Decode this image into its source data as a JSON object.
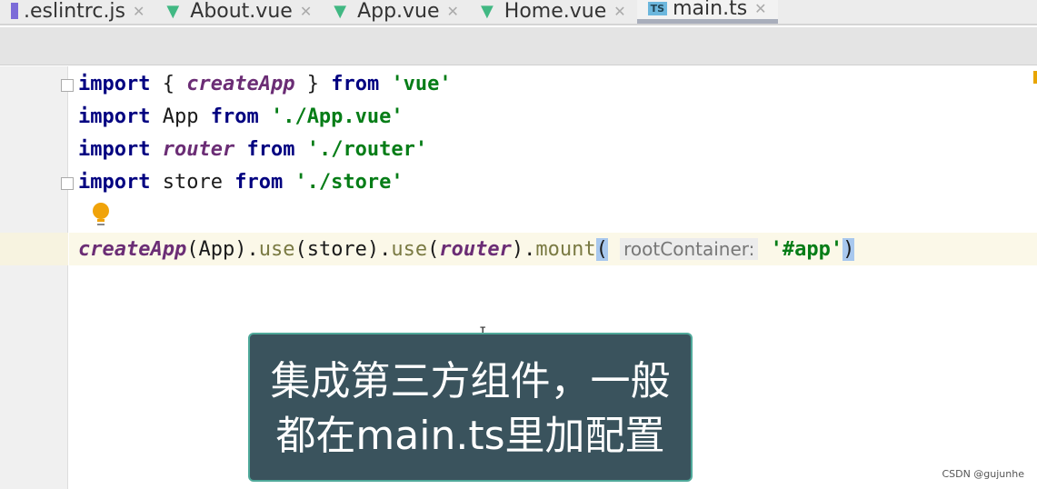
{
  "tabs": [
    {
      "label": ".eslintrc.js",
      "icon": "eslint-icon"
    },
    {
      "label": "About.vue",
      "icon": "vue-icon"
    },
    {
      "label": "App.vue",
      "icon": "vue-icon"
    },
    {
      "label": "Home.vue",
      "icon": "vue-icon"
    },
    {
      "label": "main.ts",
      "icon": "ts-icon",
      "active": true
    }
  ],
  "ts_badge": "TS",
  "code": {
    "l1": {
      "a": "import",
      "b": " { ",
      "c": "createApp",
      "d": " } ",
      "e": "from",
      "f": " ",
      "g": "'vue'"
    },
    "l2": {
      "a": "import",
      "b": " App ",
      "e": "from",
      "g": "'./App.vue'"
    },
    "l3": {
      "a": "import",
      "c": "router",
      "e": "from",
      "g": "'./router'"
    },
    "l4": {
      "a": "import",
      "b": " store ",
      "e": "from",
      "g": "'./store'"
    },
    "l6": {
      "fn": "createApp",
      "p1": "(App).",
      "use": "use",
      "p2": "(store).",
      "use2": "use",
      "p3": "(",
      "router": "router",
      "p4": ").",
      "mount": "mount",
      "open": "(",
      "hint": "rootContainer:",
      "str": "'#app'",
      "close": ")"
    }
  },
  "caption": {
    "line1": "集成第三方组件，一般",
    "line2": "都在main.ts里加配置"
  },
  "watermark": "CSDN @gujunhe",
  "colors": {
    "keyword": "#000080",
    "function": "#6b2d75",
    "string": "#067d17",
    "caption_bg": "#3a535d"
  }
}
